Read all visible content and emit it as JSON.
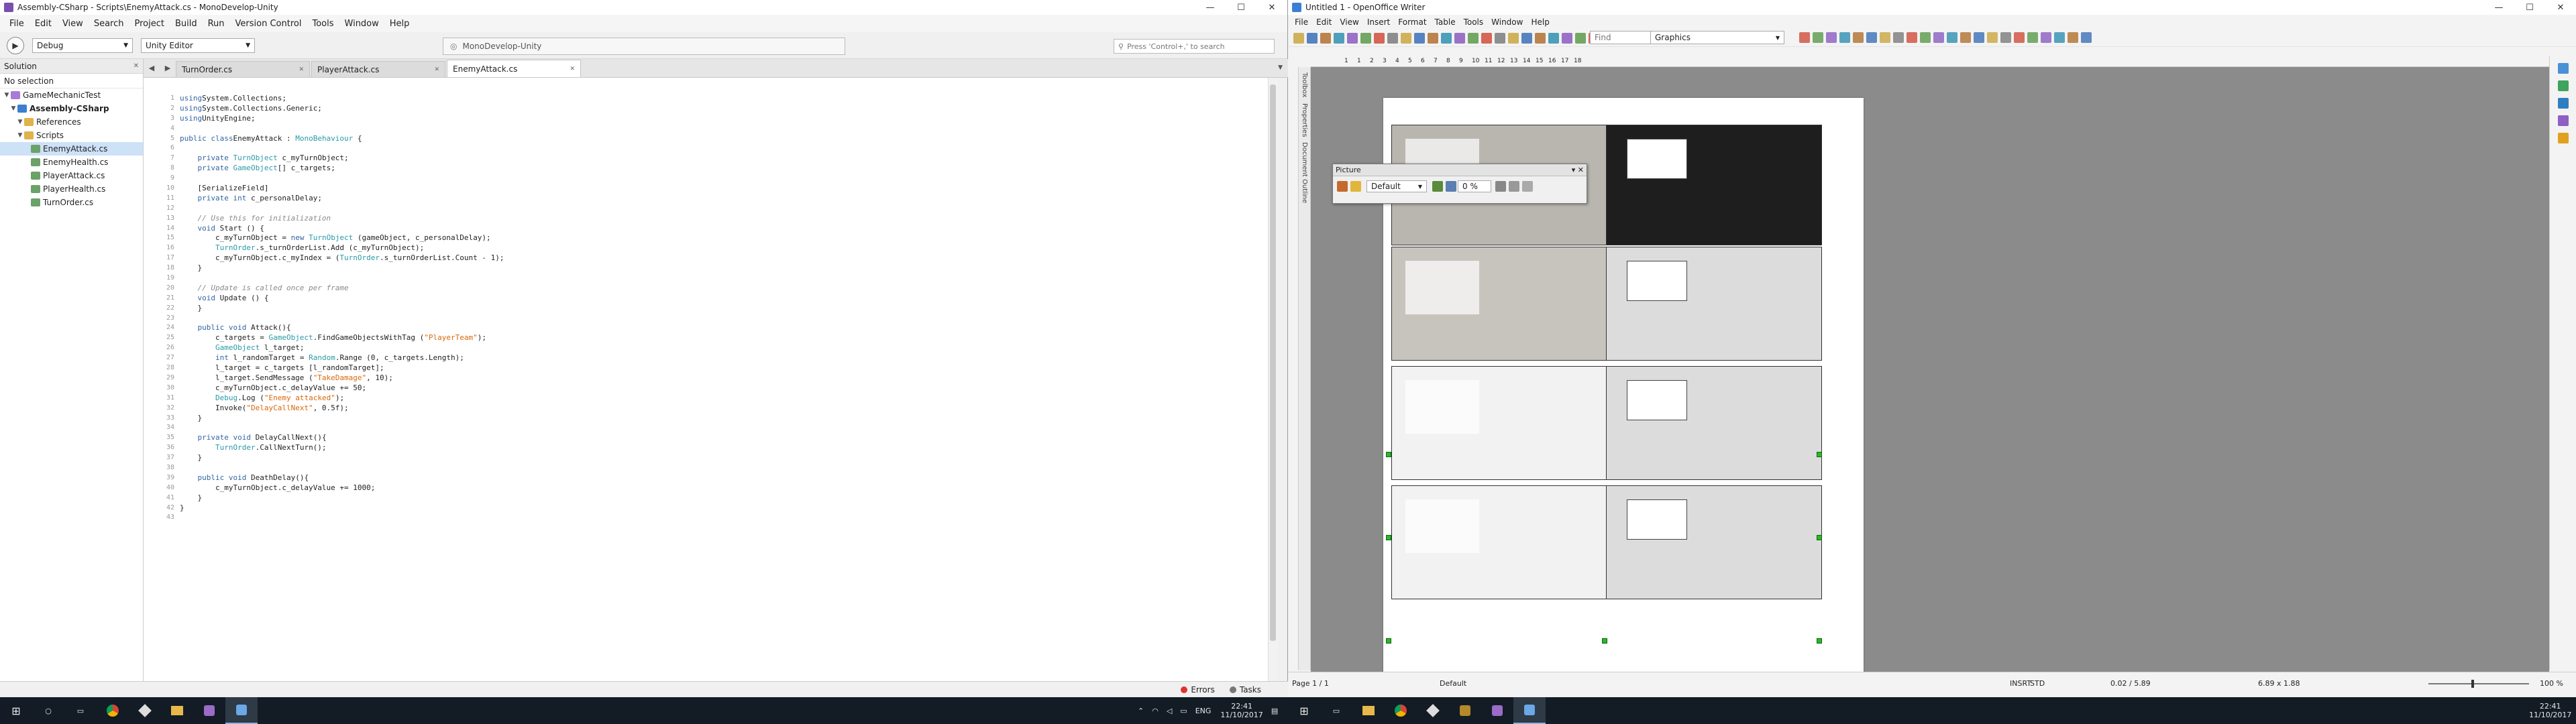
{
  "monodevelop": {
    "window_title": "Assembly-CSharp - Scripts\\EnemyAttack.cs - MonoDevelop-Unity",
    "menu": [
      "File",
      "Edit",
      "View",
      "Search",
      "Project",
      "Build",
      "Run",
      "Version Control",
      "Tools",
      "Window",
      "Help"
    ],
    "config_select": "Debug",
    "target_select": "Unity Editor",
    "status_text": "MonoDevelop-Unity",
    "search_placeholder": "Press 'Control+,' to search",
    "solution_label": "Solution",
    "no_selection": "No selection",
    "tree": [
      {
        "label": "GameMechanicTest",
        "level": 0,
        "kind": "solution"
      },
      {
        "label": "Assembly-CSharp",
        "level": 1,
        "kind": "project"
      },
      {
        "label": "References",
        "level": 2,
        "kind": "folder"
      },
      {
        "label": "Scripts",
        "level": 2,
        "kind": "folder"
      },
      {
        "label": "EnemyAttack.cs",
        "level": 3,
        "kind": "file",
        "selected": true
      },
      {
        "label": "EnemyHealth.cs",
        "level": 3,
        "kind": "file"
      },
      {
        "label": "PlayerAttack.cs",
        "level": 3,
        "kind": "file"
      },
      {
        "label": "PlayerHealth.cs",
        "level": 3,
        "kind": "file"
      },
      {
        "label": "TurnOrder.cs",
        "level": 3,
        "kind": "file"
      }
    ],
    "tabs": [
      {
        "label": "TurnOrder.cs",
        "active": false
      },
      {
        "label": "PlayerAttack.cs",
        "active": false
      },
      {
        "label": "EnemyAttack.cs",
        "active": true
      }
    ],
    "code_lines": [
      [
        [
          "kw",
          "using"
        ],
        [
          "",
          "System.Collections;"
        ]
      ],
      [
        [
          "kw",
          "using"
        ],
        [
          "",
          "System.Collections.Generic;"
        ]
      ],
      [
        [
          "kw",
          "using"
        ],
        [
          "",
          "UnityEngine;"
        ]
      ],
      [],
      [
        [
          "kw",
          "public class"
        ],
        [
          "",
          "EnemyAttack : "
        ],
        [
          "ty",
          "MonoBehaviour"
        ],
        [
          "",
          " {"
        ]
      ],
      [],
      [
        [
          "",
          "    "
        ],
        [
          "kw",
          "private"
        ],
        [
          "",
          " "
        ],
        [
          "ty",
          "TurnObject"
        ],
        [
          "",
          " c_myTurnObject;"
        ]
      ],
      [
        [
          "",
          "    "
        ],
        [
          "kw",
          "private"
        ],
        [
          "",
          " "
        ],
        [
          "ty",
          "GameObject"
        ],
        [
          "",
          "[] c_targets;"
        ]
      ],
      [],
      [
        [
          "",
          "    [SerializeField]"
        ]
      ],
      [
        [
          "",
          "    "
        ],
        [
          "kw",
          "private int"
        ],
        [
          "",
          " c_personalDelay;"
        ]
      ],
      [],
      [
        [
          "cm",
          "    // Use this for initialization"
        ]
      ],
      [
        [
          "",
          "    "
        ],
        [
          "kw",
          "void"
        ],
        [
          "",
          " Start () {"
        ]
      ],
      [
        [
          "",
          "        c_myTurnObject = "
        ],
        [
          "kw",
          "new"
        ],
        [
          "",
          " "
        ],
        [
          "ty",
          "TurnObject"
        ],
        [
          "",
          " (gameObject, c_personalDelay);"
        ]
      ],
      [
        [
          "",
          "        "
        ],
        [
          "ty",
          "TurnOrder"
        ],
        [
          "",
          ".s_turnOrderList.Add (c_myTurnObject);"
        ]
      ],
      [
        [
          "",
          "        c_myTurnObject.c_myIndex = ("
        ],
        [
          "ty",
          "TurnOrder"
        ],
        [
          "",
          ".s_turnOrderList.Count - 1);"
        ]
      ],
      [
        [
          "",
          "    }"
        ]
      ],
      [],
      [
        [
          "cm",
          "    // Update is called once per frame"
        ]
      ],
      [
        [
          "",
          "    "
        ],
        [
          "kw",
          "void"
        ],
        [
          "",
          " Update () {"
        ]
      ],
      [
        [
          "",
          "    }"
        ]
      ],
      [],
      [
        [
          "",
          "    "
        ],
        [
          "kw",
          "public void"
        ],
        [
          "",
          " Attack(){"
        ]
      ],
      [
        [
          "",
          "        c_targets = "
        ],
        [
          "ty",
          "GameObject"
        ],
        [
          "",
          ".FindGameObjectsWithTag ("
        ],
        [
          "st",
          "\"PlayerTeam\""
        ],
        [
          "",
          ");"
        ]
      ],
      [
        [
          "",
          "        "
        ],
        [
          "ty",
          "GameObject"
        ],
        [
          "",
          " l_target;"
        ]
      ],
      [
        [
          "",
          "        "
        ],
        [
          "kw",
          "int"
        ],
        [
          "",
          " l_randomTarget = "
        ],
        [
          "ty",
          "Random"
        ],
        [
          "",
          ".Range (0, c_targets.Length);"
        ]
      ],
      [
        [
          "",
          "        l_target = c_targets [l_randomTarget];"
        ]
      ],
      [
        [
          "",
          "        l_target.SendMessage ("
        ],
        [
          "st",
          "\"TakeDamage\""
        ],
        [
          "",
          ", 10);"
        ]
      ],
      [
        [
          "",
          "        c_myTurnObject.c_delayValue += 50;"
        ]
      ],
      [
        [
          "",
          "        "
        ],
        [
          "ty",
          "Debug"
        ],
        [
          "",
          ".Log ("
        ],
        [
          "st",
          "\"Enemy attacked\""
        ],
        [
          "",
          ");"
        ]
      ],
      [
        [
          "",
          "        Invoke("
        ],
        [
          "st",
          "\"DelayCallNext\""
        ],
        [
          "",
          ", 0.5f);"
        ]
      ],
      [
        [
          "",
          "    }"
        ]
      ],
      [],
      [
        [
          "",
          "    "
        ],
        [
          "kw",
          "private void"
        ],
        [
          "",
          " DelayCallNext(){"
        ]
      ],
      [
        [
          "",
          "        "
        ],
        [
          "ty",
          "TurnOrder"
        ],
        [
          "",
          ".CallNextTurn();"
        ]
      ],
      [
        [
          "",
          "    }"
        ]
      ],
      [],
      [
        [
          "",
          "    "
        ],
        [
          "kw",
          "public void"
        ],
        [
          "",
          " DeathDelay(){"
        ]
      ],
      [
        [
          "",
          "        c_myTurnObject.c_delayValue += 1000;"
        ]
      ],
      [
        [
          "",
          "    }"
        ]
      ],
      [
        [
          "",
          "}"
        ]
      ],
      []
    ],
    "bottom": {
      "errors": "Errors",
      "tasks": "Tasks"
    }
  },
  "openoffice": {
    "window_title": "Untitled 1 - OpenOffice Writer",
    "menu": [
      "File",
      "Edit",
      "View",
      "Insert",
      "Format",
      "Table",
      "Tools",
      "Window",
      "Help"
    ],
    "find_placeholder": "Find",
    "graphics_select": "Graphics",
    "ruler_ticks": [
      "1",
      "1",
      "2",
      "3",
      "4",
      "5",
      "6",
      "7",
      "8",
      "9",
      "10",
      "11",
      "12",
      "13",
      "14",
      "15",
      "16",
      "17",
      "18"
    ],
    "side_tabs": [
      "Toolbox",
      "Properties",
      "Document Outline"
    ],
    "picture_dialog": {
      "title": "Picture",
      "mode": "Default",
      "percent": "0 %"
    },
    "status": {
      "page": "Page 1 / 1",
      "style": "Default",
      "insert": "INSRT",
      "std": "STD",
      "position": "0.02 / 5.89",
      "size": "6.89 x 1.88",
      "zoom": "100 %"
    }
  },
  "taskbar": {
    "lang": "ENG",
    "time_left": "22:41",
    "date_left": "11/10/2017",
    "time_right": "22:41",
    "date_right": "11/10/2017"
  },
  "colors": {
    "keyword": "#3465a4",
    "type": "#2a9aa8",
    "string": "#d9680a",
    "comment": "#8a8a8a",
    "taskbar": "#131c25",
    "selection": "#cde1f7"
  }
}
